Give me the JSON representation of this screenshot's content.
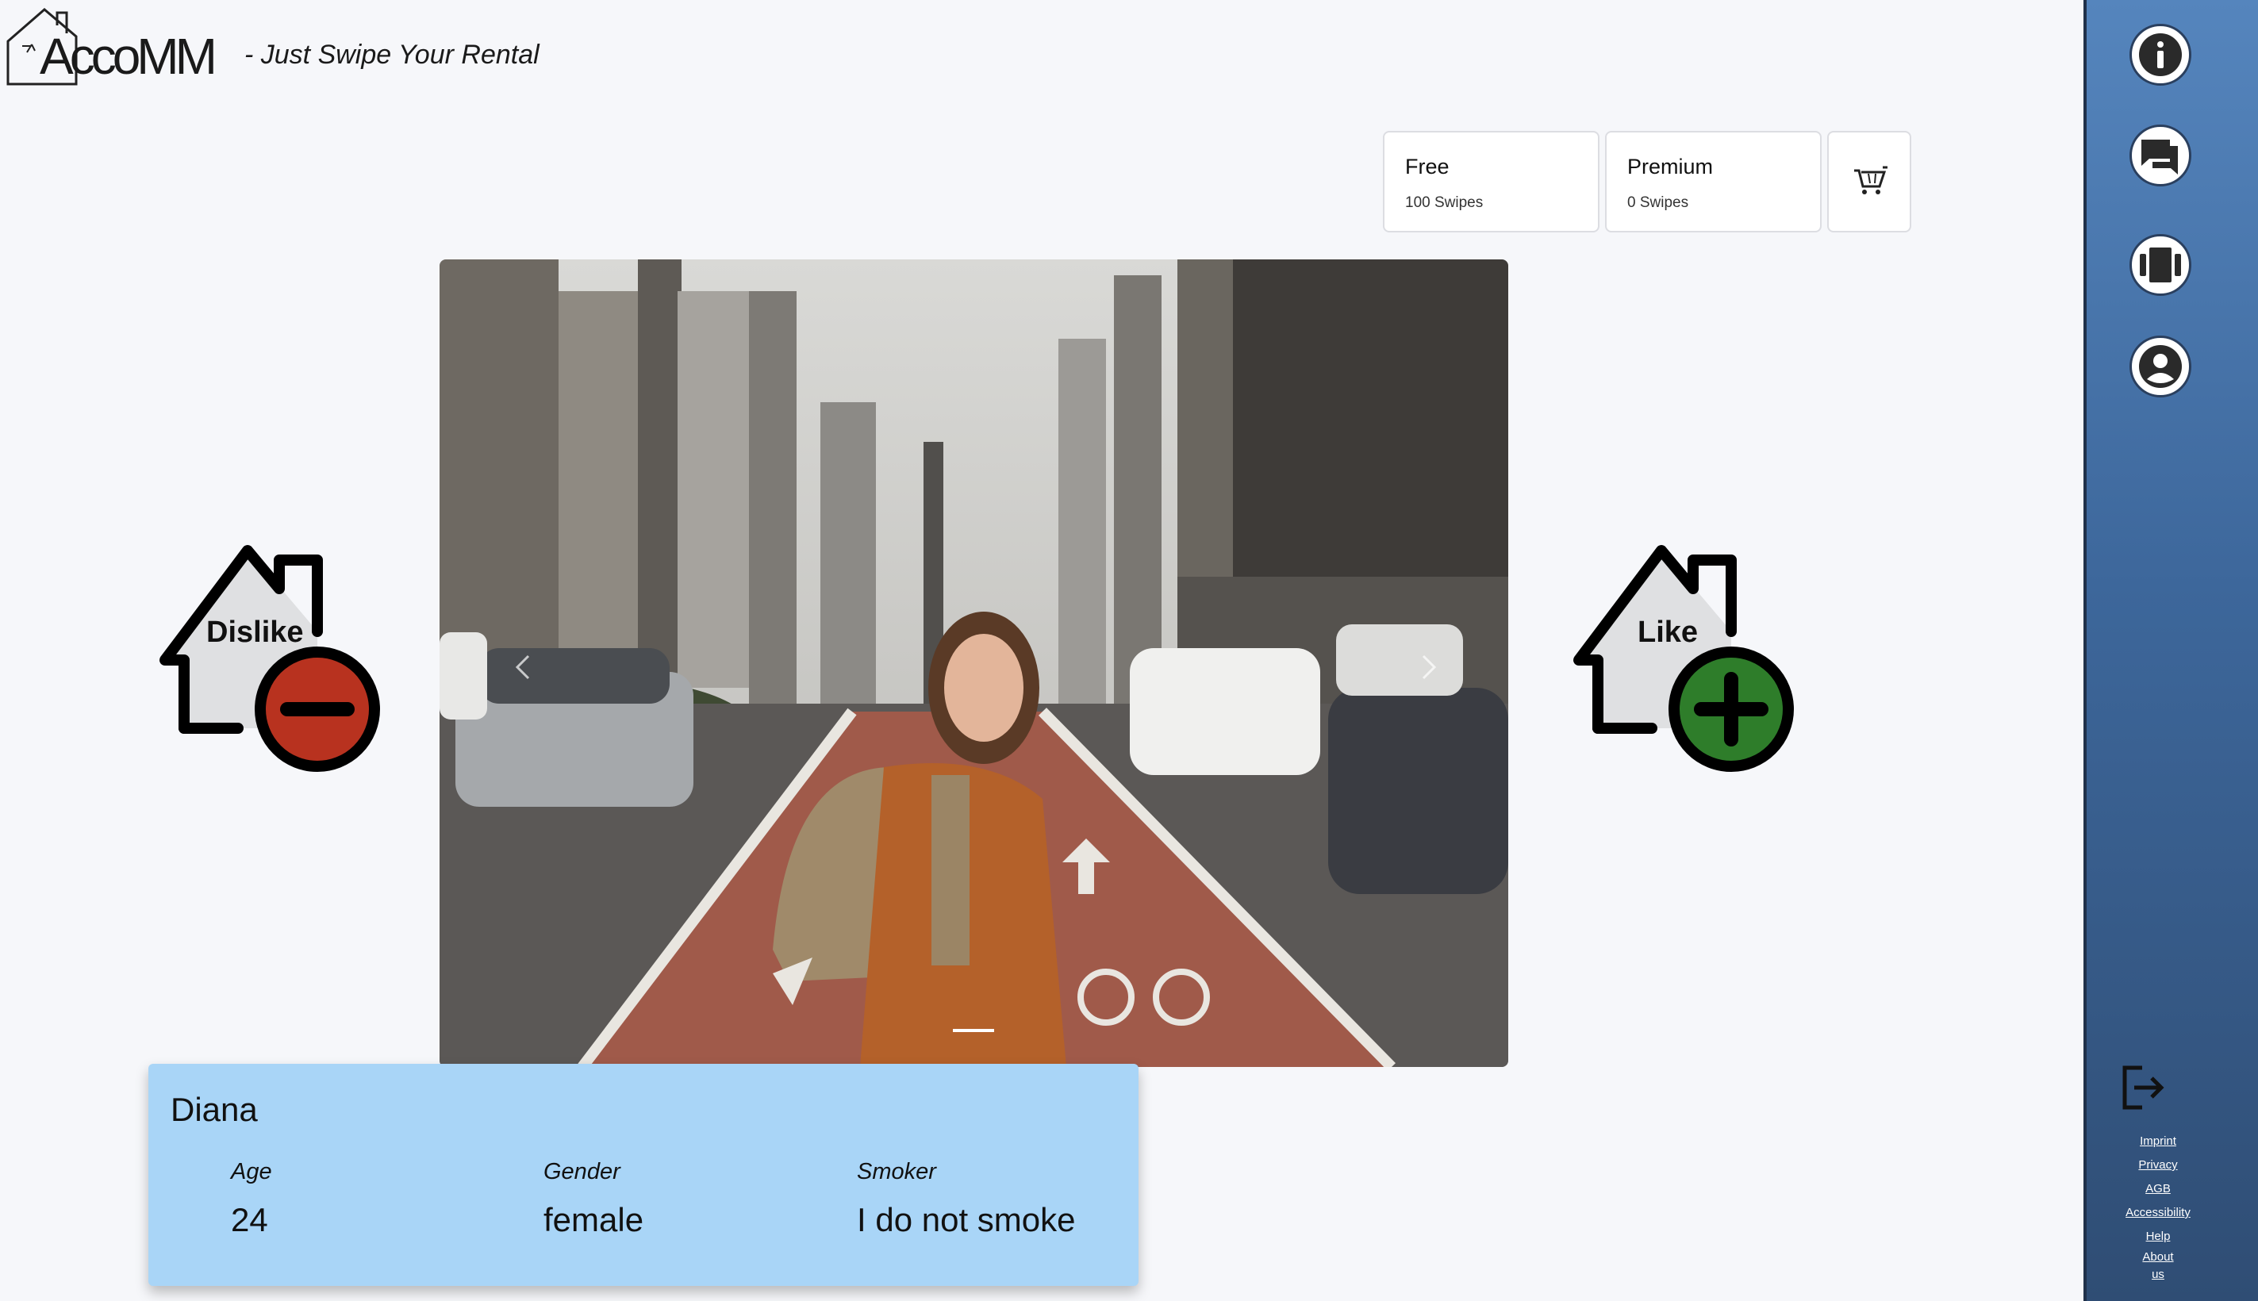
{
  "header": {
    "logo_text": "AccoMM",
    "tagline": "- Just Swipe Your Rental"
  },
  "plans": [
    {
      "name": "Free",
      "swipes": "100 Swipes"
    },
    {
      "name": "Premium",
      "swipes": "0 Swipes"
    }
  ],
  "cart": {
    "icon": "cart-icon"
  },
  "swipe": {
    "dislike_label": "Dislike",
    "like_label": "Like",
    "dislike_color": "#b8321f",
    "like_color": "#2e7d2a"
  },
  "photo": {
    "icon": "profile-photo",
    "slide_count_visible": 1
  },
  "profile": {
    "name": "Diana",
    "fields": [
      {
        "label": "Age",
        "value": "24"
      },
      {
        "label": "Gender",
        "value": "female"
      },
      {
        "label": "Smoker",
        "value": "I do not smoke"
      }
    ]
  },
  "sidebar": {
    "icons": [
      "info-icon",
      "chat-icon",
      "swipe-view-icon",
      "profile-icon",
      "logout-icon"
    ],
    "footer_links": [
      "Imprint",
      "Privacy",
      "AGB",
      "Accessibility",
      "Help",
      "About us"
    ]
  },
  "colors": {
    "background": "#f6f7fa",
    "card": "#a9d5f7",
    "sidebar_top": "#5585bd",
    "sidebar_bottom": "#2f4d74"
  }
}
